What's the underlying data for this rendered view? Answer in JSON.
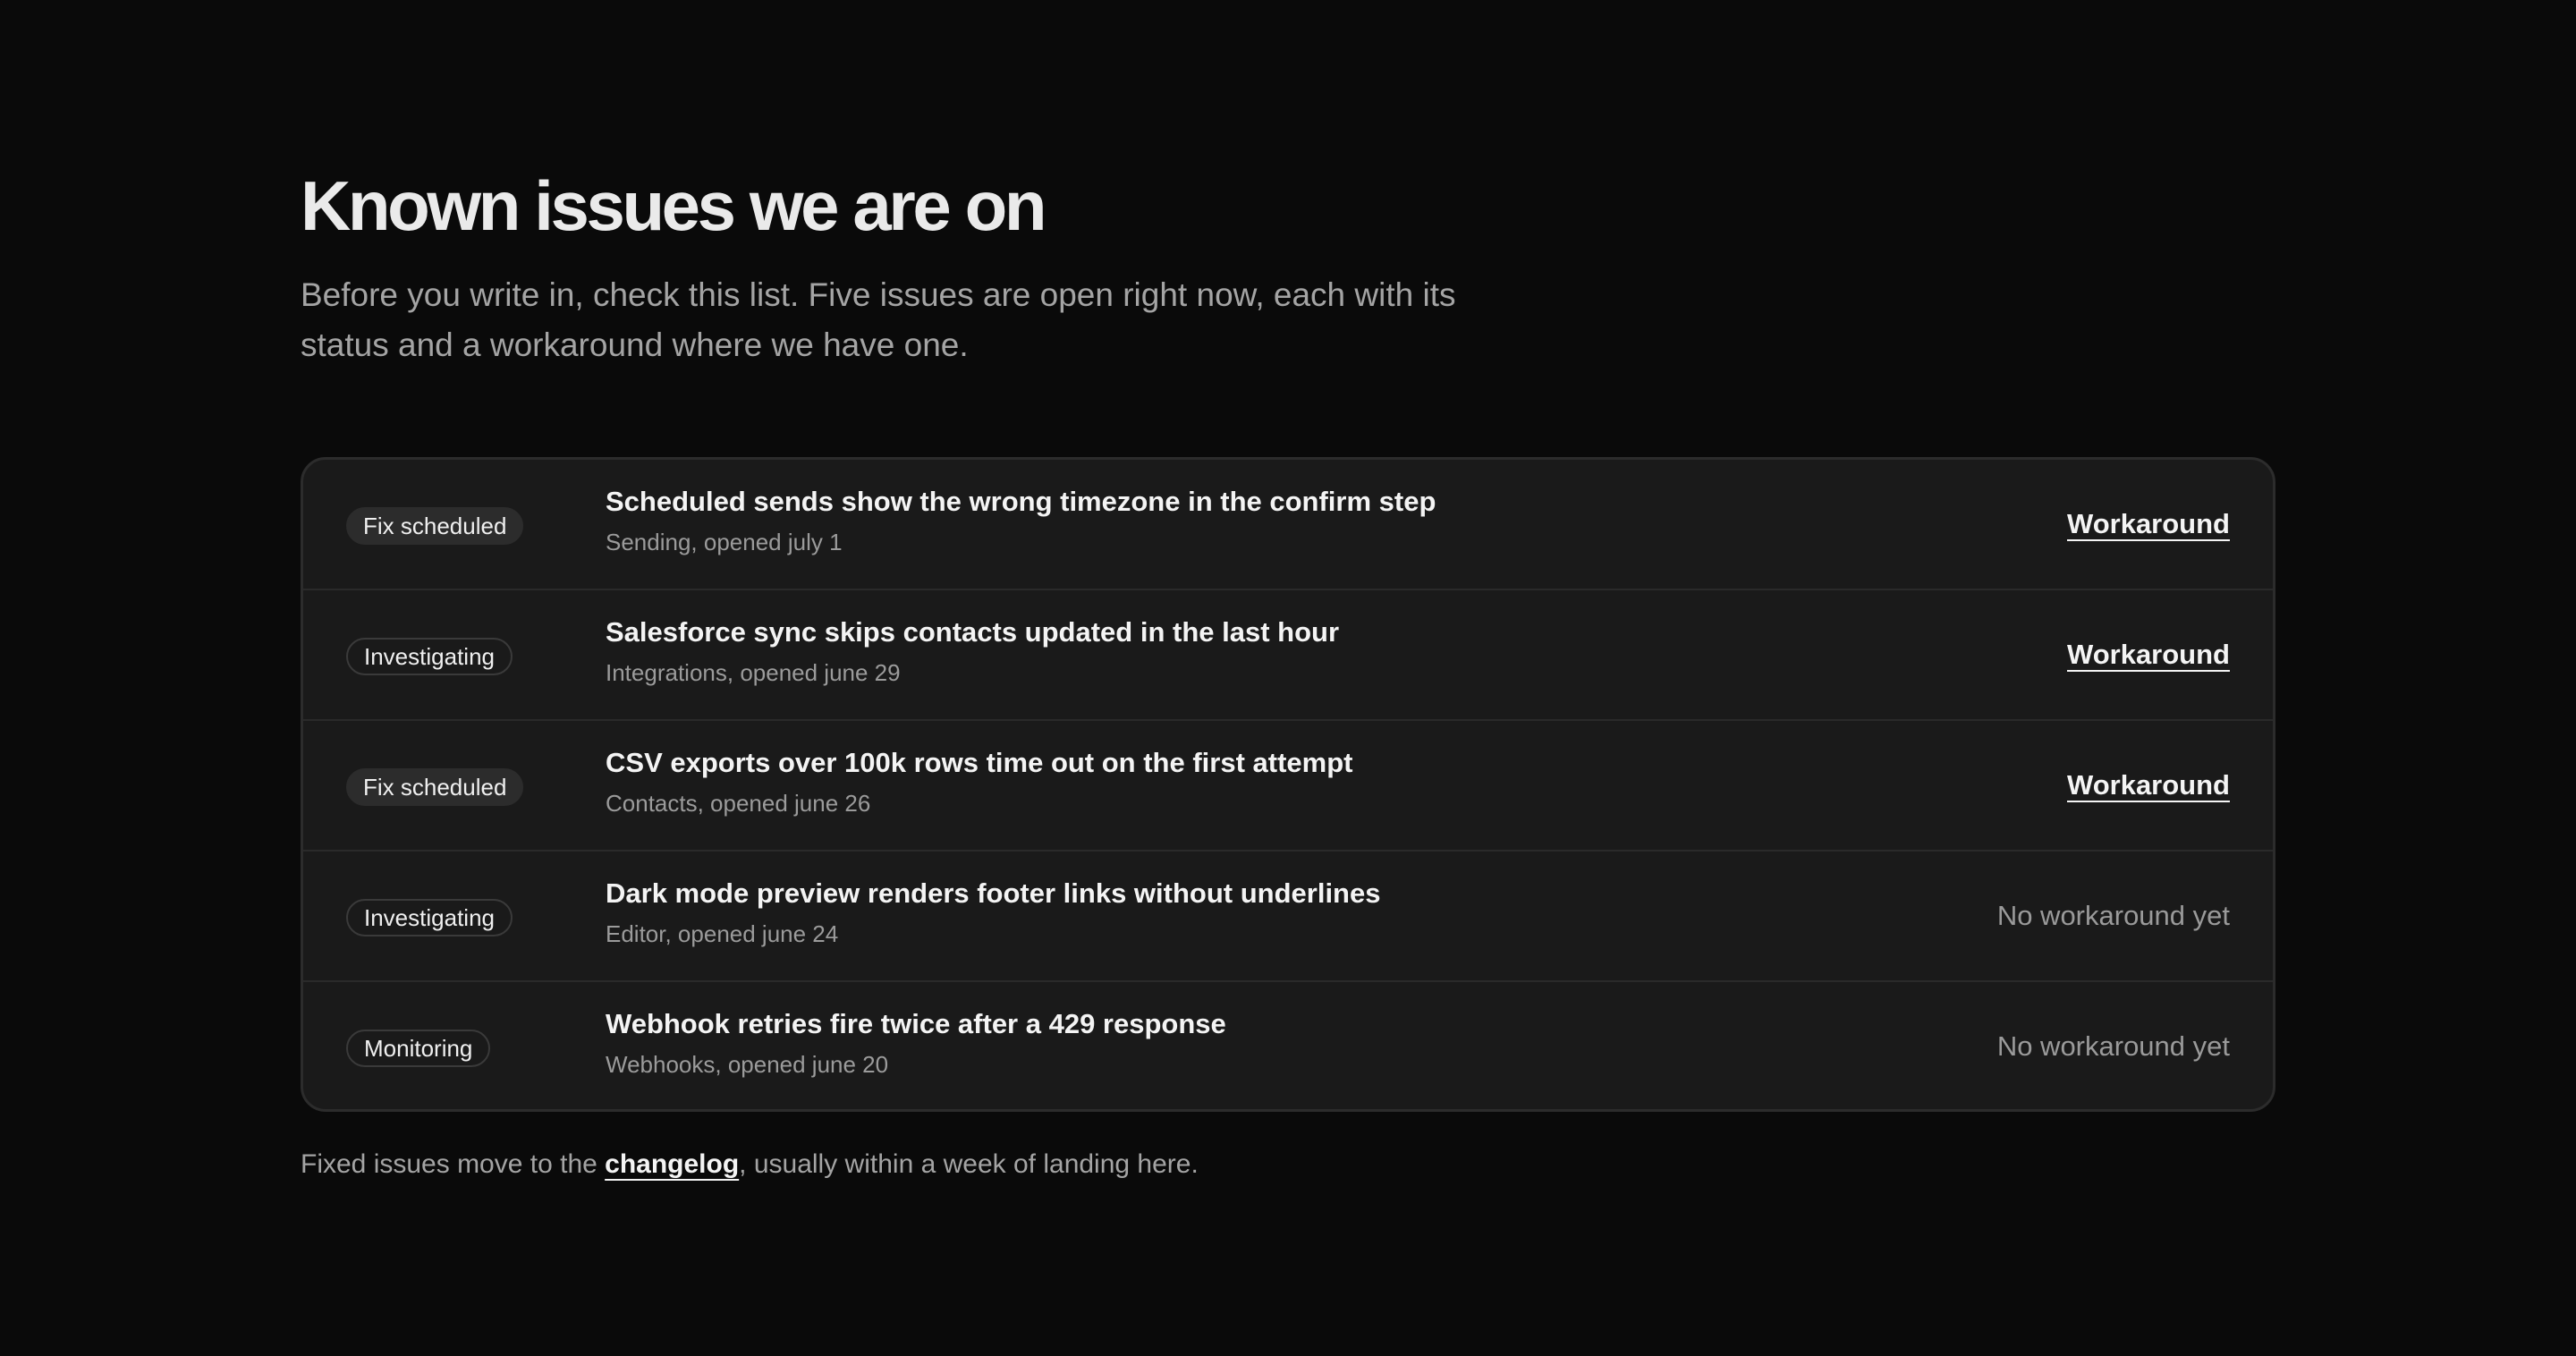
{
  "page": {
    "title": "Known issues we are on",
    "subtitle": "Before you write in, check this list. Five issues are open right now, each with its status and a workaround where we have one."
  },
  "issues": [
    {
      "status": "Fix scheduled",
      "title": "Scheduled sends show the wrong timezone in the confirm step",
      "meta": "Sending, opened july 1",
      "workaround": "Workaround"
    },
    {
      "status": "Investigating",
      "title": "Salesforce sync skips contacts updated in the last hour",
      "meta": "Integrations, opened june 29",
      "workaround": "Workaround"
    },
    {
      "status": "Fix scheduled",
      "title": "CSV exports over 100k rows time out on the first attempt",
      "meta": "Contacts, opened june 26",
      "workaround": "Workaround"
    },
    {
      "status": "Investigating",
      "title": "Dark mode preview renders footer links without underlines",
      "meta": "Editor, opened june 24",
      "workaround": "No workaround yet"
    },
    {
      "status": "Monitoring",
      "title": "Webhook retries fire twice after a 429 response",
      "meta": "Webhooks, opened june 20",
      "workaround": "No workaround yet"
    }
  ],
  "footer": {
    "prefix": "Fixed issues move to the ",
    "link_label": "changelog",
    "suffix": ", usually within a week of landing here."
  },
  "colors": {
    "background": "#0a0a0a",
    "card": "#1a1a1a",
    "text_primary": "#f4f4f4",
    "text_muted": "#a4a4a4"
  }
}
